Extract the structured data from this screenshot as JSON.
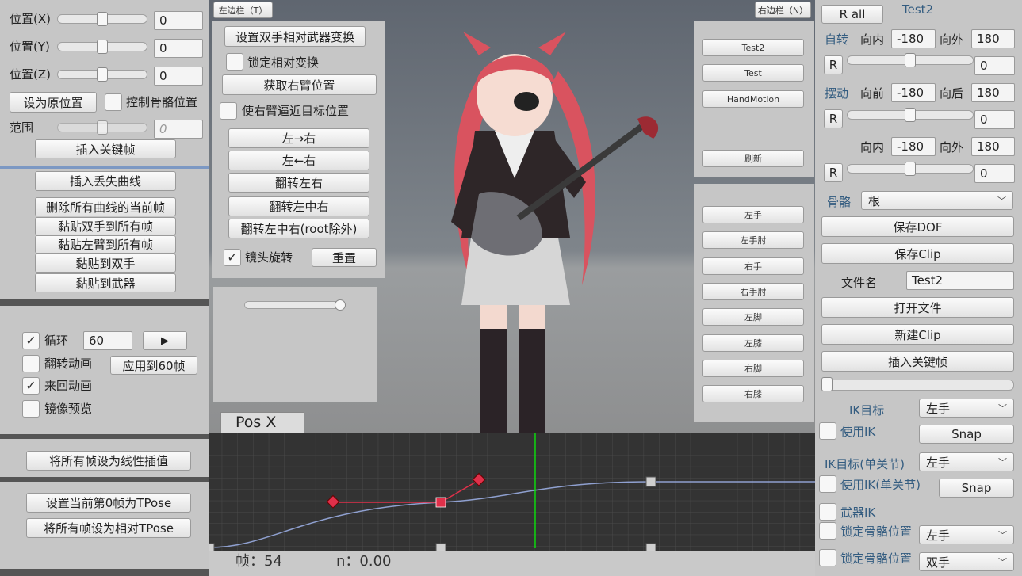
{
  "colors": {
    "panel_bg": "#c6c6c6",
    "curve_bg": "#333333",
    "curve_line": "#8fa0d0",
    "key_red": "#e0304a",
    "playhead": "#00ff00"
  },
  "left_panel": {
    "pos_x": {
      "label": "位置(X)",
      "value": "0",
      "slider": 0.5
    },
    "pos_y": {
      "label": "位置(Y)",
      "value": "0",
      "slider": 0.5
    },
    "pos_z": {
      "label": "位置(Z)",
      "value": "0",
      "slider": 0.5
    },
    "reset_pos_button": "设为原位置",
    "control_bone_pos": {
      "label": "控制骨骼位置",
      "checked": false
    },
    "range": {
      "label": "范围",
      "value": "0",
      "slider": 0.5
    },
    "insert_keyframe_button": "插入关键帧",
    "curve_buttons": [
      "插入丢失曲线",
      "删除所有曲线的当前帧",
      "黏贴双手到所有帧",
      "黏贴左臂到所有帧",
      "黏贴到双手",
      "黏贴到武器"
    ],
    "loop": {
      "label": "循环",
      "checked": true,
      "value": "60"
    },
    "play_icon": "play-icon",
    "flip_anim": {
      "label": "翻转动画",
      "checked": false
    },
    "apply_60_button": "应用到60帧",
    "pingpong": {
      "label": "来回动画",
      "checked": true
    },
    "mirror_preview": {
      "label": "镜像预览",
      "checked": false
    },
    "linear_button": "将所有帧设为线性插值",
    "tpose_frame0_button": "设置当前第0帧为TPose",
    "tpose_relative_button": "将所有帧设为相对TPose"
  },
  "left_sidebar_tab": "左边栏（T）",
  "right_sidebar_tab": "右边栏（N）",
  "mid_panel": {
    "set_hands_button": "设置双手相对武器变换",
    "lock_relative": {
      "label": "锁定相对变换",
      "checked": false
    },
    "get_right_arm_button": "获取右臂位置",
    "approach_target": {
      "label": "使右臂逼近目标位置",
      "checked": false
    },
    "mirror_buttons": [
      "左→右",
      "左←右",
      "翻转左右",
      "翻转左中右",
      "翻转左中右(root除外)"
    ],
    "camera_rotate": {
      "label": "镜头旋转",
      "checked": true
    },
    "reset_button": "重置",
    "slider_value": 0.95
  },
  "clip_list": [
    "Test2",
    "Test",
    "HandMotion"
  ],
  "refresh_button": "刷新",
  "bone_buttons": [
    "左手",
    "左手肘",
    "右手",
    "右手肘",
    "左脚",
    "左膝",
    "右脚",
    "右膝"
  ],
  "right_panel": {
    "r_all_button": "R all",
    "clip_title": "Test2",
    "rotate": {
      "label": "自转",
      "in_label": "向内",
      "in_value": "-180",
      "out_label": "向外",
      "out_value": "180",
      "r": "R",
      "value": "0",
      "slider": 0.5
    },
    "swing": {
      "label": "摆动",
      "in_label": "向前",
      "in_value": "-180",
      "out_label": "向后",
      "out_value": "180",
      "r": "R",
      "value": "0",
      "slider": 0.5
    },
    "twist": {
      "in_label": "向内",
      "in_value": "-180",
      "out_label": "向外",
      "out_value": "180",
      "r": "R",
      "value": "0",
      "slider": 0.5
    },
    "bone_label": "骨骼",
    "bone_value": "根",
    "save_dof_button": "保存DOF",
    "save_clip_button": "保存Clip",
    "filename_label": "文件名",
    "filename_value": "Test2",
    "open_file_button": "打开文件",
    "new_clip_button": "新建Clip",
    "insert_keyframe_button": "插入关键帧",
    "timeline_slider": 0.0,
    "ik_target_label": "IK目标",
    "ik_target_value": "左手",
    "use_ik": {
      "label": "使用IK",
      "checked": false
    },
    "snap_button": "Snap",
    "ik_single_label": "IK目标(单关节)",
    "ik_single_value": "左手",
    "use_ik_single": {
      "label": "使用IK(单关节)",
      "checked": false
    },
    "snap_button_2": "Snap",
    "weapon_ik": {
      "label": "武器IK",
      "checked": false
    },
    "lock_bone_1": {
      "label": "锁定骨骼位置",
      "checked": false,
      "value": "左手"
    },
    "lock_bone_2": {
      "label": "锁定骨骼位置",
      "checked": false,
      "value": "双手"
    }
  },
  "curve_editor": {
    "property": "Pos X",
    "frame_label": "帧：54",
    "n_label": "n：0.00"
  }
}
